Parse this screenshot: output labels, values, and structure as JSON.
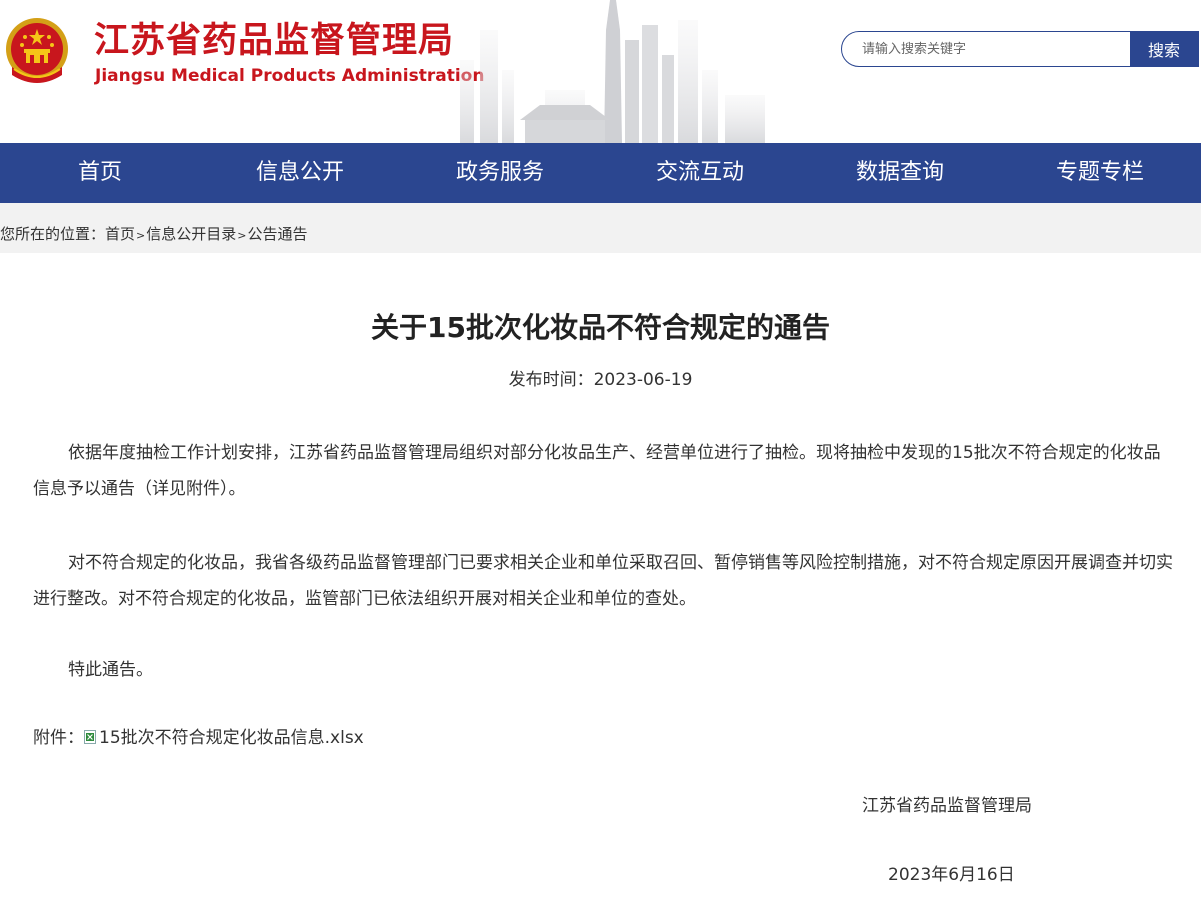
{
  "header": {
    "title_cn": "江苏省药品监督管理局",
    "title_en": "Jiangsu Medical Products Administration",
    "emblem_icon": "national-emblem-icon",
    "skyline_image": "city-skyline-graphic"
  },
  "search": {
    "placeholder": "请输入搜索关键字",
    "button_label": "搜索"
  },
  "nav": {
    "items": [
      "首页",
      "信息公开",
      "政务服务",
      "交流互动",
      "数据查询",
      "专题专栏"
    ]
  },
  "breadcrumb": {
    "prefix": "您所在的位置：",
    "items": [
      "首页",
      "信息公开目录",
      "公告通告"
    ],
    "separator": ">"
  },
  "article": {
    "title": "关于15批次化妆品不符合规定的通告",
    "publish_date": "发布时间：2023-06-19",
    "paragraphs": [
      "依据年度抽检工作计划安排，江苏省药品监督管理局组织对部分化妆品生产、经营单位进行了抽检。现将抽检中发现的15批次不符合规定的化妆品信息予以通告（详见附件）。",
      "对不符合规定的化妆品，我省各级药品监督管理部门已要求相关企业和单位采取召回、暂停销售等风险控制措施，对不符合规定原因开展调查并切实进行整改。对不符合规定的化妆品，监管部门已依法组织开展对相关企业和单位的查处。",
      "特此通告。"
    ],
    "attachment_label": "附件：",
    "attachment_name": "15批次不符合规定化妆品信息.xlsx",
    "signature_org": "江苏省药品监督管理局",
    "signature_date": "2023年6月16日"
  },
  "colors": {
    "brand_red": "#c8161d",
    "nav_blue": "#2b4690",
    "crumb_bg": "#f2f2f2"
  }
}
